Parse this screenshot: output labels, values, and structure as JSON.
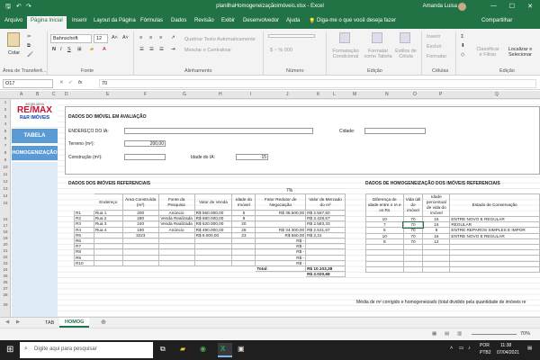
{
  "window": {
    "title": "planilhaHomogeneizaçãoimóveis.xlsx - Excel",
    "user": "Amanda Luisa"
  },
  "tabs": [
    "Arquivo",
    "Página Inicial",
    "Inserir",
    "Layout da Página",
    "Fórmulas",
    "Dados",
    "Revisão",
    "Exibir",
    "Desenvolvedor",
    "Ajuda"
  ],
  "tell_me": "Diga-me o que você deseja fazer",
  "share": "Compartilhar",
  "ribbon": {
    "paste": "Colar",
    "font_name": "Bahnschrift",
    "font_size": "12",
    "wrap": "Quebrar Texto Automaticamente",
    "merge": "Mesclar e Centralizar",
    "cond_format": "Formatação Condicional",
    "as_table": "Formatar como Tabela",
    "cell_styles": "Estilos de Célula",
    "insert": "Inserir",
    "delete": "Excluir",
    "format": "Formatar",
    "sort": "Classificar e Filtrar",
    "find": "Localizar e Selecionar",
    "groups": {
      "clipboard": "Área de Transferê...",
      "font": "Fonte",
      "align": "Alinhamento",
      "number": "Número",
      "editing": "Edição",
      "cells": "Células",
      "edit2": "Edição"
    }
  },
  "formula_bar": {
    "cell": "O17",
    "fx": "fx",
    "value": "70"
  },
  "columns": [
    "A",
    "B",
    "C",
    "D",
    "E",
    "F",
    "G",
    "H",
    "I",
    "J",
    "K",
    "L",
    "M",
    "N",
    "O",
    "P",
    "Q"
  ],
  "rows": [
    "1",
    "2",
    "3",
    "4",
    "5",
    "6",
    "7",
    "8",
    "9",
    "10",
    "11",
    "12",
    "13",
    "14",
    "15",
    "16",
    "17",
    "18",
    "19",
    "20",
    "21",
    "22",
    "23",
    "24",
    "25",
    "26",
    "27",
    "28",
    "29"
  ],
  "logo": {
    "small": "IMOBILIÁRIA",
    "brand": "RE/MAX",
    "sub": "R&R IMÓVEIS"
  },
  "nav": {
    "tabela": "TABELA",
    "homog": "HOMOGENIZAÇÃO"
  },
  "form": {
    "heading": "DADOS DO IMÓVEL EM AVALIAÇÃO",
    "endereco": "ENDEREÇO DO IA:",
    "cidade": "Cidade:",
    "terreno": "Terreno (m²):",
    "terreno_val": "200,00",
    "construcao": "Construção (m²):",
    "idade": "Idade do IA:",
    "idade_val": "15"
  },
  "ref": {
    "heading": "DADOS DOS IMÓVEIS REFERENCIAIS",
    "pct": "7%",
    "headers": [
      "",
      "Endereço",
      "Área Construída (m²)",
      "Fonte da Pesquisa",
      "Valor de Venda",
      "Idade do Imóvel",
      "Fator Redutor de Negociação",
      "Valor de Mercado do m²"
    ],
    "rows": [
      [
        "R1",
        "Rua 1",
        "200",
        "Anúncio",
        "R$ 550.000,00",
        "5",
        "R$ 38.500,00",
        "R$ 2.557,50"
      ],
      [
        "R2",
        "Rua 2",
        "280",
        "Venda Realizada",
        "R$ 680.000,00",
        "8",
        "",
        "R$ 2.428,57"
      ],
      [
        "R3",
        "Rua 3",
        "240",
        "Venda Realizada",
        "R$ 620.000,00",
        "20",
        "",
        "R$ 2.583,33"
      ],
      [
        "R4",
        "Rua 4",
        "180",
        "Anúncio",
        "R$ 490.000,00",
        "25",
        "R$ 34.300,00",
        "R$ 2.531,67"
      ],
      [
        "R5",
        "",
        "3223",
        "",
        "R$ 8.000,00",
        "23",
        "R$ 560,00",
        "R$ 2,31"
      ],
      [
        "R6",
        "",
        "",
        "",
        "",
        "",
        "R$ -",
        ""
      ],
      [
        "R7",
        "",
        "",
        "",
        "",
        "",
        "R$ -",
        ""
      ],
      [
        "R8",
        "",
        "",
        "",
        "",
        "",
        "R$ -",
        ""
      ],
      [
        "R9",
        "",
        "",
        "",
        "",
        "",
        "R$ -",
        ""
      ],
      [
        "R10",
        "",
        "",
        "",
        "",
        "",
        "R$ -",
        ""
      ]
    ],
    "total_label": "Total:",
    "total": "R$ 10.103,38",
    "avg": "R$ 2.020,68"
  },
  "homog": {
    "heading": "DADOS DE HOMOGENEIZAÇÃO DOS IMÓVEIS REFERENCIAIS",
    "headers": [
      "Diferença de idade entre o IA e os Rs",
      "Vida útil do imóvel",
      "Idade percentual de vida do imóvel",
      "Estado de Conservação"
    ],
    "rows": [
      [
        "10",
        "70",
        "16",
        "ENTRE NOVO E REGULAR"
      ],
      [
        "7",
        "70",
        "16",
        "REGULAR"
      ],
      [
        "5",
        "70",
        "8",
        "ENTRE REPAROS SIMPLES E IMPOR"
      ],
      [
        "10",
        "70",
        "16",
        "ENTRE NOVO E REGULAR"
      ],
      [
        "8",
        "70",
        "12",
        ""
      ]
    ],
    "note": "Média de m² corrigido e homogeneizado (total dividido pela quantidade de imóveis re"
  },
  "sheets": [
    "TAB",
    "HOMOG"
  ],
  "status": {
    "zoom": "70%"
  },
  "taskbar": {
    "search": "Digite aqui para pesquisar",
    "lang": "POR",
    "kbd": "PTB2",
    "time": "11:38",
    "date": "07/04/2021"
  }
}
